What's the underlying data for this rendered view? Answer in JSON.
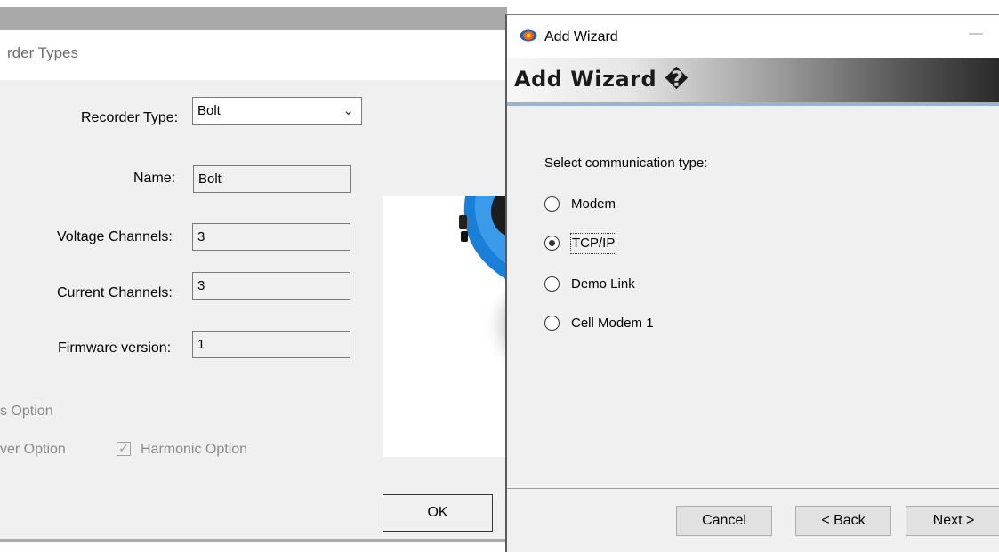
{
  "recorder_dialog": {
    "caption": "rder Types",
    "recorder_type_label": "Recorder Type:",
    "recorder_type_value": "Bolt",
    "name_label": "Name:",
    "name_value": "Bolt",
    "voltage_label": "Voltage Channels:",
    "voltage_value": "3",
    "current_label": "Current Channels:",
    "current_value": "3",
    "firmware_label": "Firmware version:",
    "firmware_value": "1",
    "option_cut1": "s Option",
    "option_cut2": "ver Option",
    "harmonic_label": "Harmonic Option",
    "harmonic_checked": true,
    "ok_label": "OK"
  },
  "wizard": {
    "window_title": "Add Wizard",
    "minimize_glyph": "—",
    "header_title": "Add Wizard �",
    "prompt": "Select communication type:",
    "options": [
      {
        "label": "Modem",
        "selected": false
      },
      {
        "label": "TCP/IP",
        "selected": true
      },
      {
        "label": "Demo Link",
        "selected": false
      },
      {
        "label": "Cell Modem 1",
        "selected": false
      }
    ],
    "buttons": {
      "cancel": "Cancel",
      "back": "< Back",
      "next": "Next >"
    }
  },
  "colors": {
    "device_blue": "#1a7fd6",
    "header_line": "#9bb3cf"
  }
}
